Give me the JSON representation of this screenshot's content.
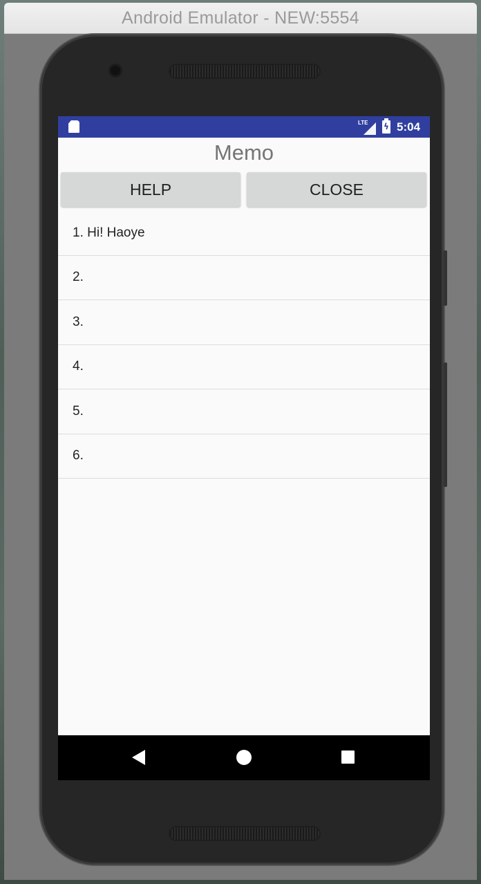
{
  "window": {
    "title": "Android Emulator - NEW:5554"
  },
  "status_bar": {
    "time": "5:04",
    "network": "LTE",
    "sd_icon": "sd-card-icon",
    "battery_icon": "battery-charging-icon"
  },
  "app": {
    "title": "Memo",
    "buttons": {
      "help": "HELP",
      "close": "CLOSE"
    },
    "memos": [
      {
        "label": "1. Hi! Haoye"
      },
      {
        "label": "2."
      },
      {
        "label": "3."
      },
      {
        "label": "4."
      },
      {
        "label": "5."
      },
      {
        "label": "6."
      }
    ]
  },
  "nav_bar": {
    "back_icon": "back-triangle-icon",
    "home_icon": "home-circle-icon",
    "recents_icon": "recents-square-icon"
  },
  "colors": {
    "status_bar": "#303f9f",
    "screen_bg": "#fafafa",
    "button_bg": "#d6d7d7",
    "title_text": "#757575"
  }
}
